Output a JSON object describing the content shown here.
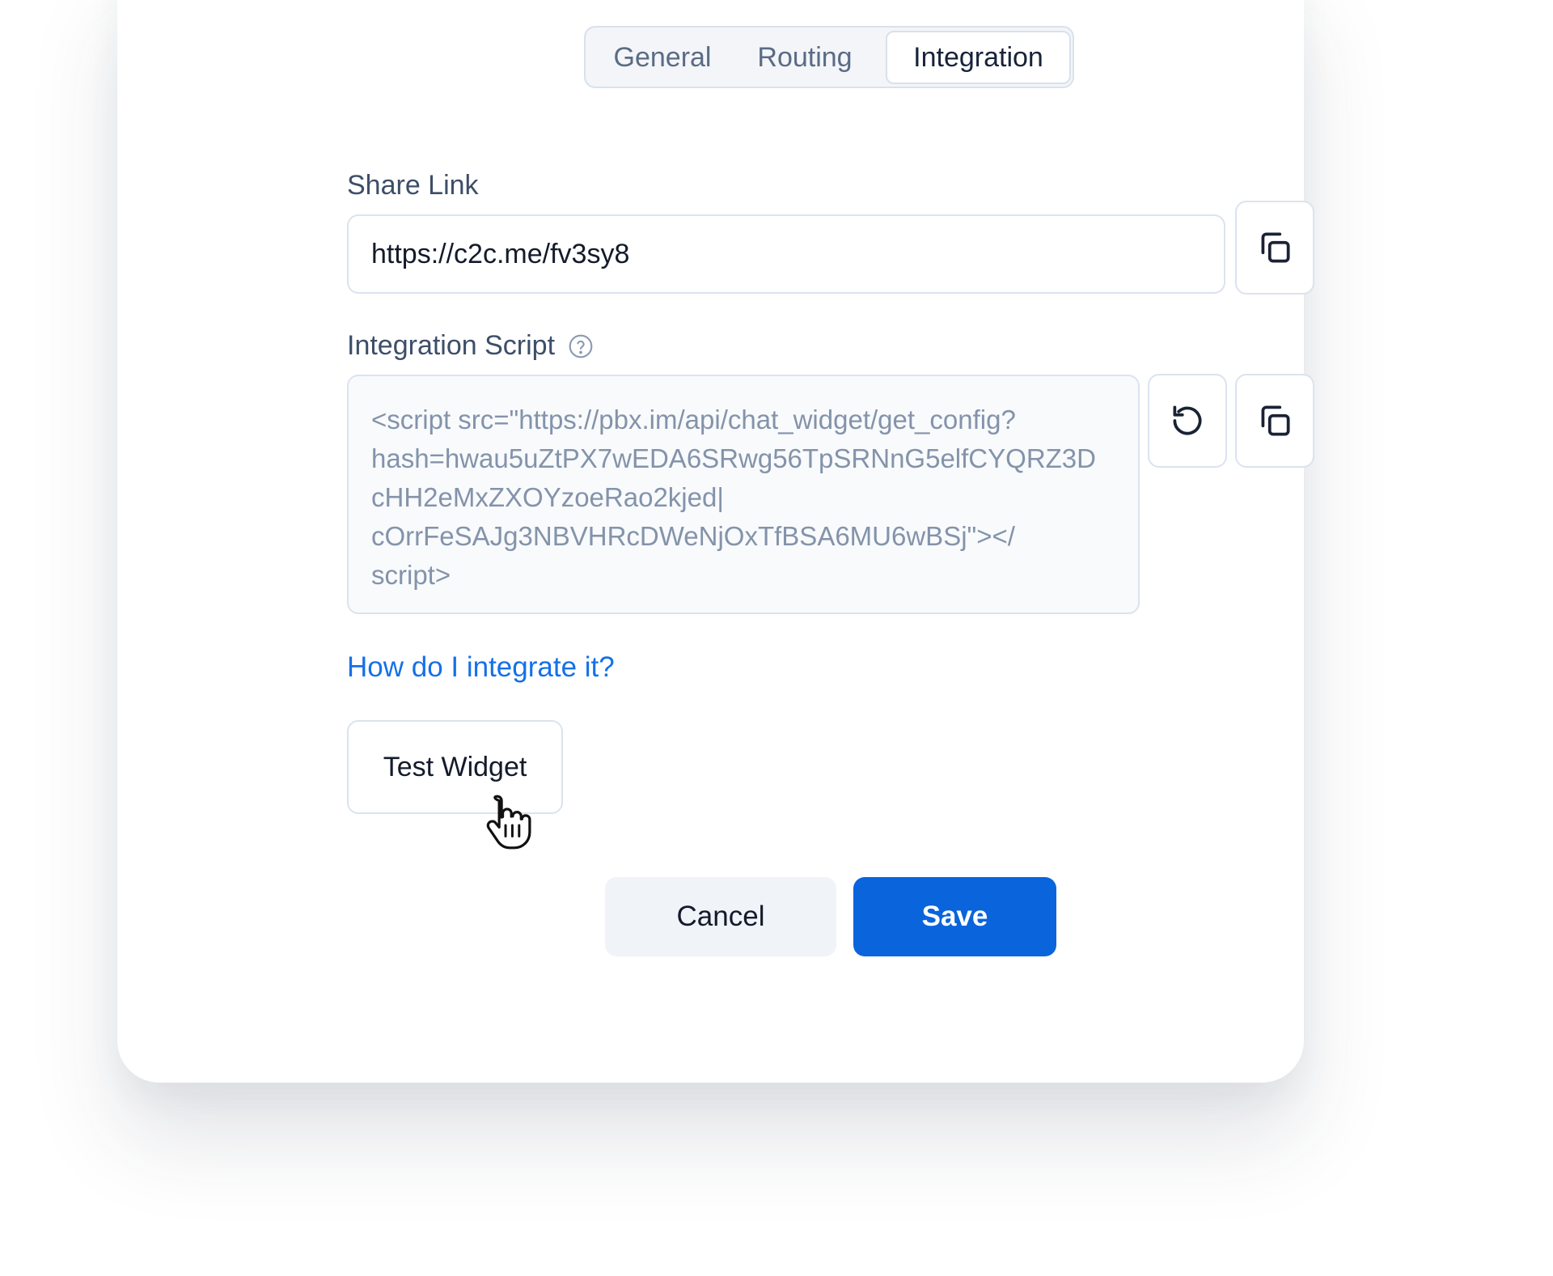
{
  "tabs": {
    "items": [
      {
        "label": "General"
      },
      {
        "label": "Routing"
      },
      {
        "label": "Integration"
      }
    ],
    "active": "Integration"
  },
  "share_link": {
    "label": "Share Link",
    "value": "https://c2c.me/fv3sy8",
    "copy_icon": "copy-icon"
  },
  "integration_script": {
    "label": "Integration Script",
    "help_icon": "question-circle-icon",
    "value": "<script src=\"https://pbx.im/api/chat_widget/get_config?\nhash=hwau5uZtPX7wEDA6SRwg56TpSRNnG5elfCYQRZ3D\ncHH2eMxZXOYzoeRao2kjed|\ncOrrFeSAJg3NBVHRcDWeNjOxTfBSA6MU6wBSj\"></\nscript>",
    "reset_icon": "refresh-icon",
    "copy_icon": "copy-icon"
  },
  "help_link": "How do I integrate it?",
  "test_button": "Test Widget",
  "footer": {
    "cancel_label": "Cancel",
    "save_label": "Save"
  },
  "colors": {
    "accent": "#0a64dc",
    "link": "#1570e8",
    "border": "#dbe3ee",
    "muted_text": "#8493aa"
  }
}
